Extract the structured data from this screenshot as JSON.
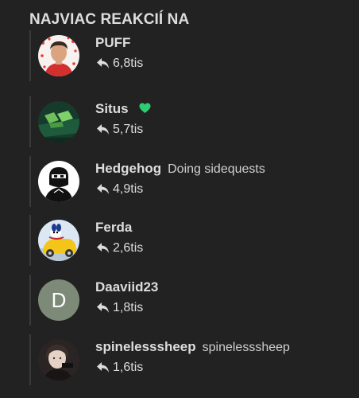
{
  "panel": {
    "title": "NAJVIAC REAKCIÍ NA"
  },
  "users": [
    {
      "name": "PUFF",
      "status": "",
      "count": "6,8tis",
      "avatar_icon": "profile-photo-red",
      "avatar_color": "#e53935"
    },
    {
      "name": "Situs",
      "status": "",
      "badge_icon": "green-heart-icon",
      "count": "5,7tis",
      "avatar_icon": "profile-photo-green",
      "avatar_color": "#1f4d3a"
    },
    {
      "name": "Hedgehog",
      "status": "Doing sidequests",
      "count": "4,9tis",
      "avatar_icon": "profile-photo-bw",
      "avatar_color": "#111111"
    },
    {
      "name": "Ferda",
      "status": "",
      "count": "2,6tis",
      "avatar_icon": "profile-photo-cartoon",
      "avatar_color": "#f3c51a"
    },
    {
      "name": "Daaviid23",
      "status": "",
      "count": "1,8tis",
      "avatar_letter": "D",
      "avatar_color": "#7d8a78"
    },
    {
      "name": "spinelesssheep",
      "status": "spinelesssheep",
      "count": "1,6tis",
      "avatar_icon": "profile-photo-dark",
      "avatar_color": "#3a3030"
    }
  ],
  "colors": {
    "background": "#222222",
    "text": "#dddddd",
    "divider": "#3a3a3a",
    "heart": "#2ecc71"
  }
}
